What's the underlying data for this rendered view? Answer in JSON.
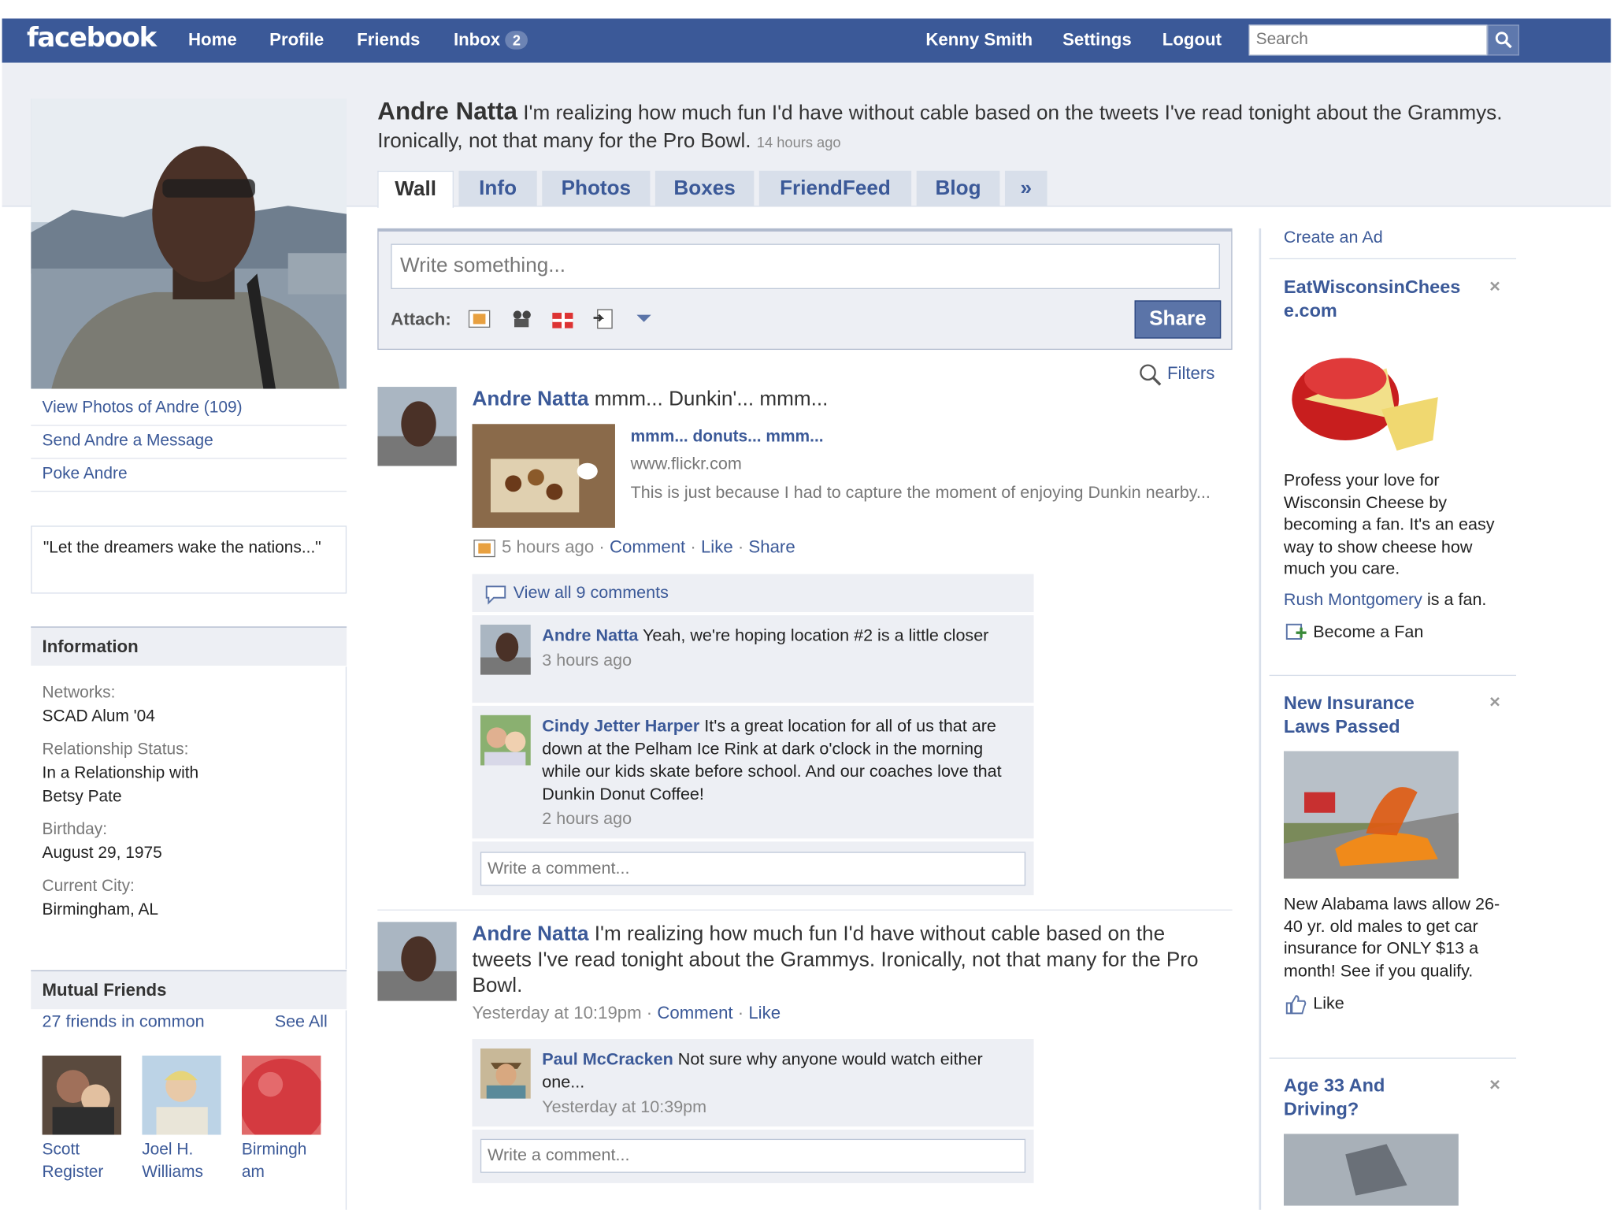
{
  "colors": {
    "brand": "#3b5998",
    "band": "#edeff4",
    "border": "#d8dfea"
  },
  "topbar": {
    "logo": "facebook",
    "nav": [
      "Home",
      "Profile",
      "Friends",
      "Inbox"
    ],
    "inbox_count": "2",
    "user": "Kenny Smith",
    "settings": "Settings",
    "logout": "Logout",
    "search_placeholder": "Search",
    "search_icon": "magnifier-icon"
  },
  "profile": {
    "links": [
      "View Photos of Andre (109)",
      "Send Andre a Message",
      "Poke Andre"
    ],
    "quote": "\"Let the dreamers wake the nations...\""
  },
  "information": {
    "title": "Information",
    "networks_label": "Networks:",
    "networks": "SCAD Alum '04",
    "relationship_label": "Relationship Status:",
    "relationship": "In a Relationship with",
    "partner": "Betsy Pate",
    "birthday_label": "Birthday:",
    "birthday": "August 29, 1975",
    "city_label": "Current City:",
    "city": "Birmingham, AL"
  },
  "mutual": {
    "title": "Mutual Friends",
    "count": "27 friends in common",
    "see_all": "See All",
    "friends": [
      {
        "l1": "Scott",
        "l2": "Register"
      },
      {
        "l1": "Joel H.",
        "l2": "Williams"
      },
      {
        "l1": "Birmingh",
        "l2": "am"
      }
    ]
  },
  "status": {
    "name": "Andre Natta",
    "text": "I'm realizing how much fun I'd have without cable based on the tweets I've read tonight about the Grammys. Ironically, not that many for the Pro Bowl.",
    "time": "14 hours ago"
  },
  "tabs": [
    "Wall",
    "Info",
    "Photos",
    "Boxes",
    "FriendFeed",
    "Blog",
    "»"
  ],
  "composer": {
    "placeholder": "Write something...",
    "attach_label": "Attach:",
    "share": "Share"
  },
  "filters": "Filters",
  "post1": {
    "name": "Andre Natta",
    "text": "mmm... Dunkin'... mmm...",
    "link_title": "mmm... donuts... mmm...",
    "link_domain": "www.flickr.com",
    "link_desc": "This is just because I had to capture the moment of enjoying Dunkin nearby...",
    "time": "5 hours ago",
    "comment": "Comment",
    "like": "Like",
    "share": "Share",
    "view_all": "View all 9 comments",
    "comments": [
      {
        "name": "Andre Natta",
        "text": "Yeah, we're hoping location #2 is a little closer",
        "time": "3 hours ago"
      },
      {
        "name": "Cindy Jetter Harper",
        "text": "It's a great location for all of us that are down at the Pelham Ice Rink at dark o'clock in the morning while our kids skate before school. And our coaches love that Dunkin Donut Coffee!",
        "time": "2 hours ago"
      }
    ],
    "comment_placeholder": "Write a comment..."
  },
  "post2": {
    "name": "Andre Natta",
    "text": "I'm realizing how much fun I'd have without cable based on the tweets I've read tonight about the Grammys. Ironically, not that many for the Pro Bowl.",
    "time": "Yesterday at 10:19pm",
    "comment": "Comment",
    "like": "Like",
    "comments": [
      {
        "name": "Paul McCracken",
        "text": "Not sure why anyone would watch either one...",
        "time": "Yesterday at 10:39pm"
      }
    ],
    "comment_placeholder": "Write a comment..."
  },
  "ads": {
    "create": "Create an Ad",
    "ad1": {
      "title": "EatWisconsinCheese.com",
      "body": "Profess your love for Wisconsin Cheese by becoming a fan. It's an easy way to show cheese how much you care.",
      "fan_name": "Rush Montgomery",
      "fan_text": "is a fan.",
      "action": "Become a Fan"
    },
    "ad2": {
      "title": "New Insurance Laws Passed",
      "body": "New Alabama laws allow 26-40 yr. old males to get car insurance for ONLY $13 a month! See if you qualify.",
      "action": "Like"
    },
    "ad3": {
      "title": "Age 33 And Driving?"
    },
    "close": "×"
  }
}
